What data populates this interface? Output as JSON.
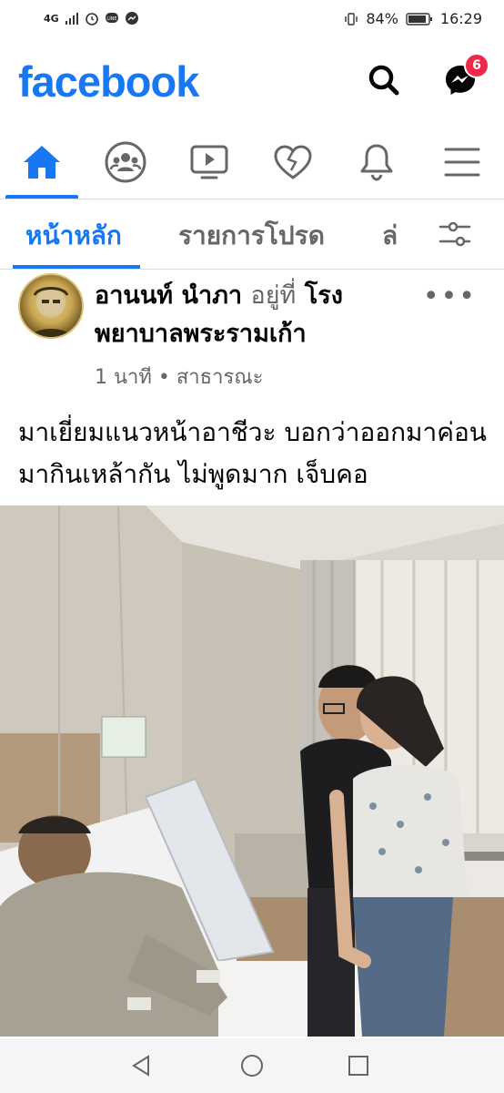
{
  "status_bar": {
    "network": "4G",
    "battery": "84%",
    "time": "16:29",
    "icons": [
      "signal-icon",
      "alarm-icon",
      "line-icon",
      "messenger-notification-icon",
      "vibrate-icon",
      "battery-icon"
    ]
  },
  "header": {
    "logo": "facebook",
    "brand_color": "#1877f2",
    "search_icon": "search-icon",
    "messenger_icon": "messenger-icon",
    "messenger_badge": "6"
  },
  "nav": {
    "items": [
      {
        "icon": "home-icon",
        "active": true
      },
      {
        "icon": "groups-icon",
        "active": false
      },
      {
        "icon": "watch-icon",
        "active": false
      },
      {
        "icon": "dating-icon",
        "active": false
      },
      {
        "icon": "bell-icon",
        "active": false
      },
      {
        "icon": "menu-icon",
        "active": false
      }
    ]
  },
  "subnav": {
    "tabs": [
      {
        "label": "หน้าหลัก",
        "active": true
      },
      {
        "label": "รายการโปรด",
        "active": false
      },
      {
        "label": "ล่",
        "active": false
      }
    ],
    "filter_icon": "filter-sliders-icon"
  },
  "post": {
    "author": "อานนท์ นำภา",
    "at": "อยู่ที่",
    "place": "โรงพยาบาลพระรามเก้า",
    "time": "1 นาที",
    "separator": "•",
    "privacy": "สาธารณะ",
    "more_label": "•••",
    "text": "มาเยี่ยมแนวหน้าอาชีวะ บอกว่าออกมาค่อนมากินเหล้ากัน ไม่พูดมาก เจ็บคอ",
    "photo_icon": "photo-hospital-room"
  },
  "bottom_bar": {
    "icons": [
      "back-icon",
      "home-circle-icon",
      "recents-icon"
    ]
  }
}
